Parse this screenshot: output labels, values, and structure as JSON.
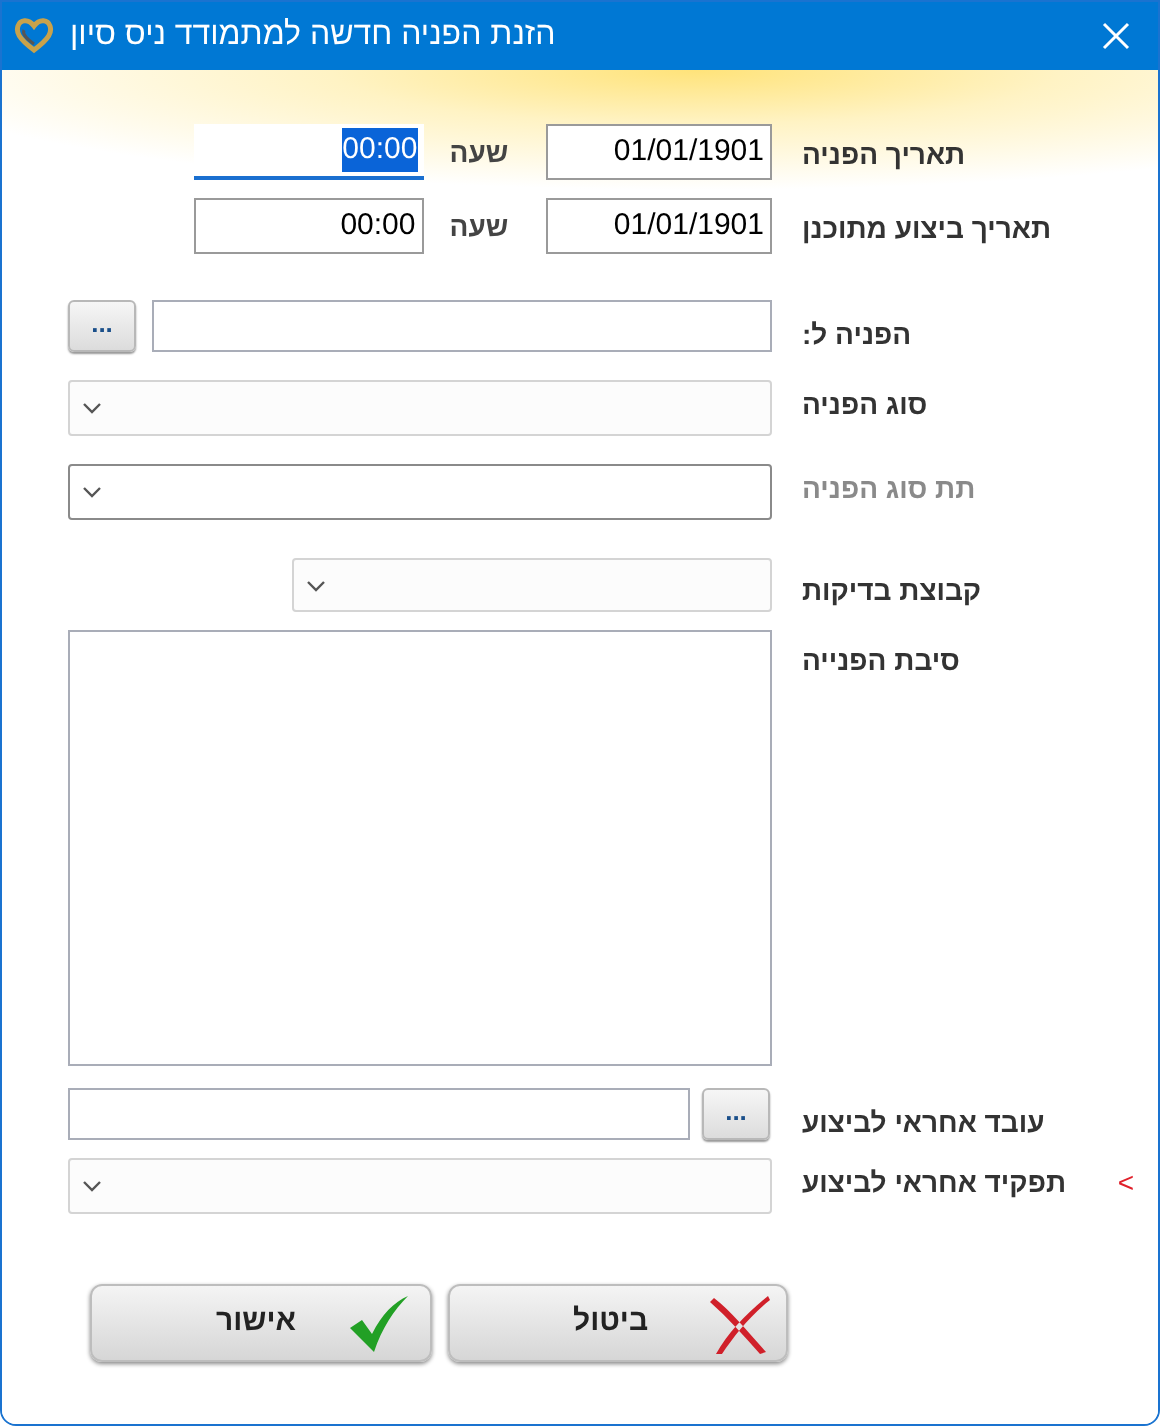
{
  "window": {
    "title": "הזנת הפניה חדשה למתמודד ניס סיון"
  },
  "rows": [
    {
      "kind": "datetime",
      "label": "תאריך הפניה",
      "date": "01/01/1901",
      "time_label": "שעה",
      "time": "00:00",
      "time_focused": true
    },
    {
      "kind": "datetime",
      "label": "תאריך ביצוע מתוכנן",
      "date": "01/01/1901",
      "time_label": "שעה",
      "time": "00:00",
      "time_focused": false
    },
    {
      "kind": "picker_left",
      "label": "הפניה ל:",
      "button": "..."
    },
    {
      "kind": "dropdown",
      "label": "סוג הפניה",
      "dimmed": false
    },
    {
      "kind": "dropdown",
      "label": "תת סוג הפניה",
      "dimmed": true
    },
    {
      "kind": "dropdown_short",
      "label": "קבוצת בדיקות",
      "dimmed": false
    },
    {
      "kind": "textarea",
      "label": "סיבת הפנייה"
    },
    {
      "kind": "picker_right",
      "label": "עובד אחראי לביצוע",
      "button": "..."
    },
    {
      "kind": "dropdown",
      "label": "תפקיד אחראי לביצוע",
      "dimmed": false,
      "marker": "<"
    }
  ],
  "buttons": [
    {
      "kind": "cancel",
      "label": "ביטול"
    },
    {
      "kind": "ok",
      "label": "אישור"
    }
  ]
}
